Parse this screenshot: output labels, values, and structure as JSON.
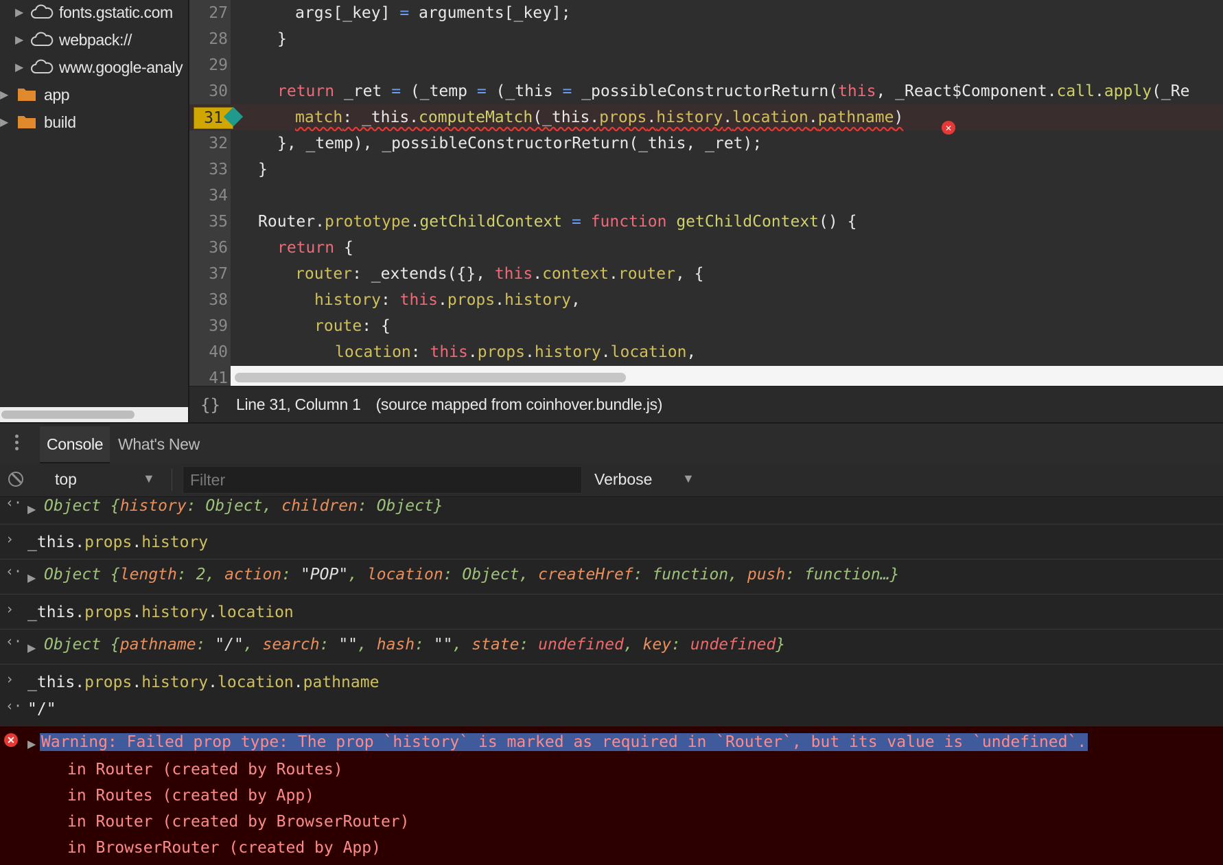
{
  "file_tree": {
    "items": [
      {
        "label": "fonts.gstatic.com",
        "icon": "cloud-icon"
      },
      {
        "label": "webpack://",
        "icon": "cloud-icon"
      },
      {
        "label": "www.google-analy",
        "icon": "cloud-icon"
      },
      {
        "label": "app",
        "icon": "folder-icon"
      },
      {
        "label": "build",
        "icon": "folder-icon"
      }
    ]
  },
  "editor": {
    "lines": [
      {
        "num": "27"
      },
      {
        "num": "28"
      },
      {
        "num": "29"
      },
      {
        "num": "30"
      },
      {
        "num": "31"
      },
      {
        "num": "32"
      },
      {
        "num": "33"
      },
      {
        "num": "34"
      },
      {
        "num": "35"
      },
      {
        "num": "36"
      },
      {
        "num": "37"
      },
      {
        "num": "38"
      },
      {
        "num": "39"
      },
      {
        "num": "40"
      },
      {
        "num": "41"
      }
    ],
    "code": {
      "l27_a": "args[_key]",
      "l27_b": " = ",
      "l27_c": "arguments[_key];",
      "l28": "}",
      "l30_ret": "return",
      "l30_a": " _ret ",
      "l30_eq": "=",
      "l30_b": " (_temp ",
      "l30_eq2": "=",
      "l30_c": " (_this ",
      "l30_eq3": "=",
      "l30_d": " _possibleConstructorReturn(",
      "l30_this": "this",
      "l30_e": ", _React$Component.",
      "l30_call": "call",
      "l30_dot": ".",
      "l30_apply": "apply",
      "l30_f": "(_Re",
      "l31_match": "match",
      "l31_a": ": _this.",
      "l31_cm": "computeMatch",
      "l31_b": "(_this.",
      "l31_props": "props",
      "l31_c": ".",
      "l31_hist": "history",
      "l31_d": ".",
      "l31_loc": "location",
      "l31_e": ".",
      "l31_path": "pathname",
      "l31_f": ")",
      "l32": "}, _temp), _possibleConstructorReturn(_this, _ret);",
      "l33": "}",
      "l35_a": "Router.",
      "l35_proto": "prototype",
      "l35_b": ".",
      "l35_gcc": "getChildContext",
      "l35_eq": " = ",
      "l35_fn": "function",
      "l35_name": " getChildContext",
      "l35_c": "() {",
      "l36_ret": "return",
      "l36_a": " {",
      "l37_router": "router",
      "l37_a": ": _extends({}, ",
      "l37_this": "this",
      "l37_b": ".",
      "l37_ctx": "context",
      "l37_c": ".",
      "l37_r": "router",
      "l37_d": ", {",
      "l38_hist": "history",
      "l38_a": ": ",
      "l38_this": "this",
      "l38_b": ".",
      "l38_props": "props",
      "l38_c": ".",
      "l38_h": "history",
      "l38_d": ",",
      "l39_route": "route",
      "l39_a": ": {",
      "l40_loc": "location",
      "l40_a": ": ",
      "l40_this": "this",
      "l40_b": ".",
      "l40_props": "props",
      "l40_c": ".",
      "l40_h": "history",
      "l40_d": ".",
      "l40_l": "location",
      "l40_e": ","
    },
    "active_line": "31"
  },
  "status_bar": {
    "braces": "{}",
    "position": "Line 31, Column 1",
    "source": "(source mapped from coinhover.bundle.js)"
  },
  "drawer": {
    "tabs": [
      "Console",
      "What's New"
    ]
  },
  "toolbar": {
    "context": "top",
    "filter_placeholder": "Filter",
    "level": "Verbose"
  },
  "console": {
    "r1": {
      "a": "Object {",
      "k1": "history",
      "b": ": ",
      "v1": "Object",
      "c": ", ",
      "k2": "children",
      "d": ": ",
      "v2": "Object",
      "e": "}"
    },
    "r2_input": {
      "a": "_this.",
      "b": "props",
      "c": ".",
      "d": "history"
    },
    "r3": {
      "a": "Object {",
      "k1": "length",
      "b": ": ",
      "v1": "2",
      "c": ", ",
      "k2": "action",
      "d": ": ",
      "v2": "\"POP\"",
      "e": ", ",
      "k3": "location",
      "f": ": ",
      "v3": "Object",
      "g": ", ",
      "k4": "createHref",
      "h": ": ",
      "v4": "function",
      "i": ", ",
      "k5": "push",
      "j": ": ",
      "v5": "function…}"
    },
    "r4_input": {
      "a": "_this.",
      "b": "props",
      "c": ".",
      "d": "history",
      "e": ".",
      "f": "location"
    },
    "r5": {
      "a": "Object {",
      "k1": "pathname",
      "b": ": ",
      "v1": "\"/\"",
      "c": ", ",
      "k2": "search",
      "d": ": ",
      "v2": "\"\"",
      "e": ", ",
      "k3": "hash",
      "f": ": ",
      "v3": "\"\"",
      "g": ", ",
      "k4": "state",
      "h": ": ",
      "v4": "undefined",
      "i": ", ",
      "k5": "key",
      "j": ": ",
      "v5": "undefined",
      "k": "}"
    },
    "r6_input": {
      "a": "_this.",
      "b": "props",
      "c": ".",
      "d": "history",
      "e": ".",
      "f": "location",
      "g": ".",
      "h": "pathname"
    },
    "r7_output": "\"/\"",
    "error": {
      "message": "Warning: Failed prop type: The prop `history` is marked as required in `Router`, but its value is `undefined`.",
      "stack": [
        "in Router (created by Routes)",
        "in Routes (created by App)",
        "in Router (created by BrowserRouter)",
        "in BrowserRouter (created by App)"
      ]
    }
  },
  "colors": {
    "error_background": "#2d0000",
    "active_line_number": "#cfa700",
    "breakpoint_marker": "#1f9a8c"
  }
}
